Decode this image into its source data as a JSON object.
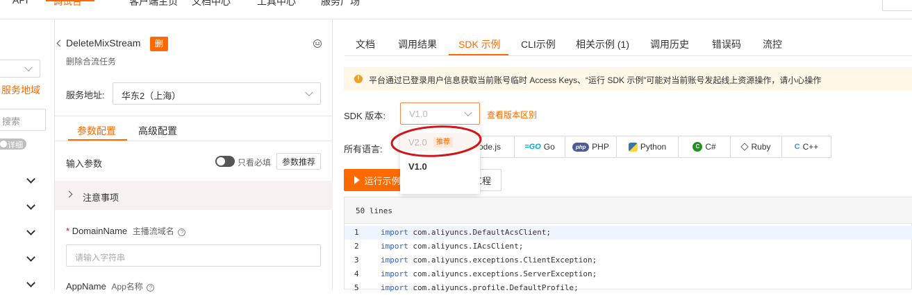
{
  "topbar": {
    "items": [
      "API",
      "调试台",
      "客户端主页",
      "文档中心",
      "工具中心",
      "服务广场"
    ]
  },
  "left_nav": {
    "service_region_label": "服务地域",
    "search_placeholder": "搜索",
    "detail_label": "详细"
  },
  "api_panel": {
    "api_name": "DeleteMixStream",
    "api_badge": "删",
    "api_description": "删除合流任务",
    "service_address_label": "服务地址:",
    "service_address_value": "华东2（上海）",
    "tabs": [
      {
        "label": "参数配置",
        "active": true
      },
      {
        "label": "高级配置",
        "active": false
      }
    ],
    "input_params_label": "输入参数",
    "required_only_label": "只看必填",
    "param_recommend_button": "参数推荐",
    "notes_label": "注意事项",
    "domain_required_mark": "*",
    "domain_name_label": "DomainName",
    "domain_name_desc": "主播流域名",
    "domain_input_placeholder": "请输入字符串",
    "app_name_label": "AppName",
    "app_name_desc": "App名称"
  },
  "sdk_panel": {
    "tabs": [
      {
        "label": "文档",
        "active": false
      },
      {
        "label": "调用结果",
        "active": false
      },
      {
        "label": "SDK 示例",
        "active": true
      },
      {
        "label": "CLI示例",
        "active": false
      },
      {
        "label": "相关示例 (1)",
        "active": false
      },
      {
        "label": "调用历史",
        "active": false
      },
      {
        "label": "错误码",
        "active": false
      },
      {
        "label": "流控",
        "active": false
      }
    ],
    "warning_text": "平台通过已登录用户信息获取当前账号临时 Access Keys、“运行 SDK 示例”可能对当前账号发起线上资源操作，请小心操作",
    "sdk_version_label": "SDK 版本:",
    "sdk_version_value": "V1.0",
    "view_version_diff_link": "查看版本区别",
    "all_languages_label": "所有语言:",
    "version_dropdown": {
      "options": [
        {
          "label": "V2.0",
          "badge": "推荐",
          "disabled": true
        },
        {
          "label": "V1.0",
          "selected": true
        }
      ]
    },
    "languages": [
      "Node.js",
      "Go",
      "PHP",
      "Python",
      "C#",
      "Ruby",
      "C++"
    ],
    "language_prefix_partial": "ode.js",
    "run_example_button": "运行示例",
    "download_button": "下载完整工程",
    "code_lines_count": "50 lines",
    "code_lines": [
      {
        "num": "1",
        "keyword": "import",
        "text": "com.aliyuncs.DefaultAcsClient;"
      },
      {
        "num": "2",
        "keyword": "import",
        "text": "com.aliyuncs.IAcsClient;"
      },
      {
        "num": "3",
        "keyword": "import",
        "text": "com.aliyuncs.exceptions.ClientException;"
      },
      {
        "num": "4",
        "keyword": "import",
        "text": "com.aliyuncs.exceptions.ServerException;"
      },
      {
        "num": "5",
        "keyword": "import",
        "text": "com.aliyuncs.profile.DefaultProfile;"
      }
    ]
  },
  "colors": {
    "accent_orange": "#ff6a00",
    "warning_bg": "#fff7e8",
    "annotation_red": "#d0161b",
    "code_bg": "#f7f7f7",
    "keyword_blue": "#2b5fc7"
  }
}
